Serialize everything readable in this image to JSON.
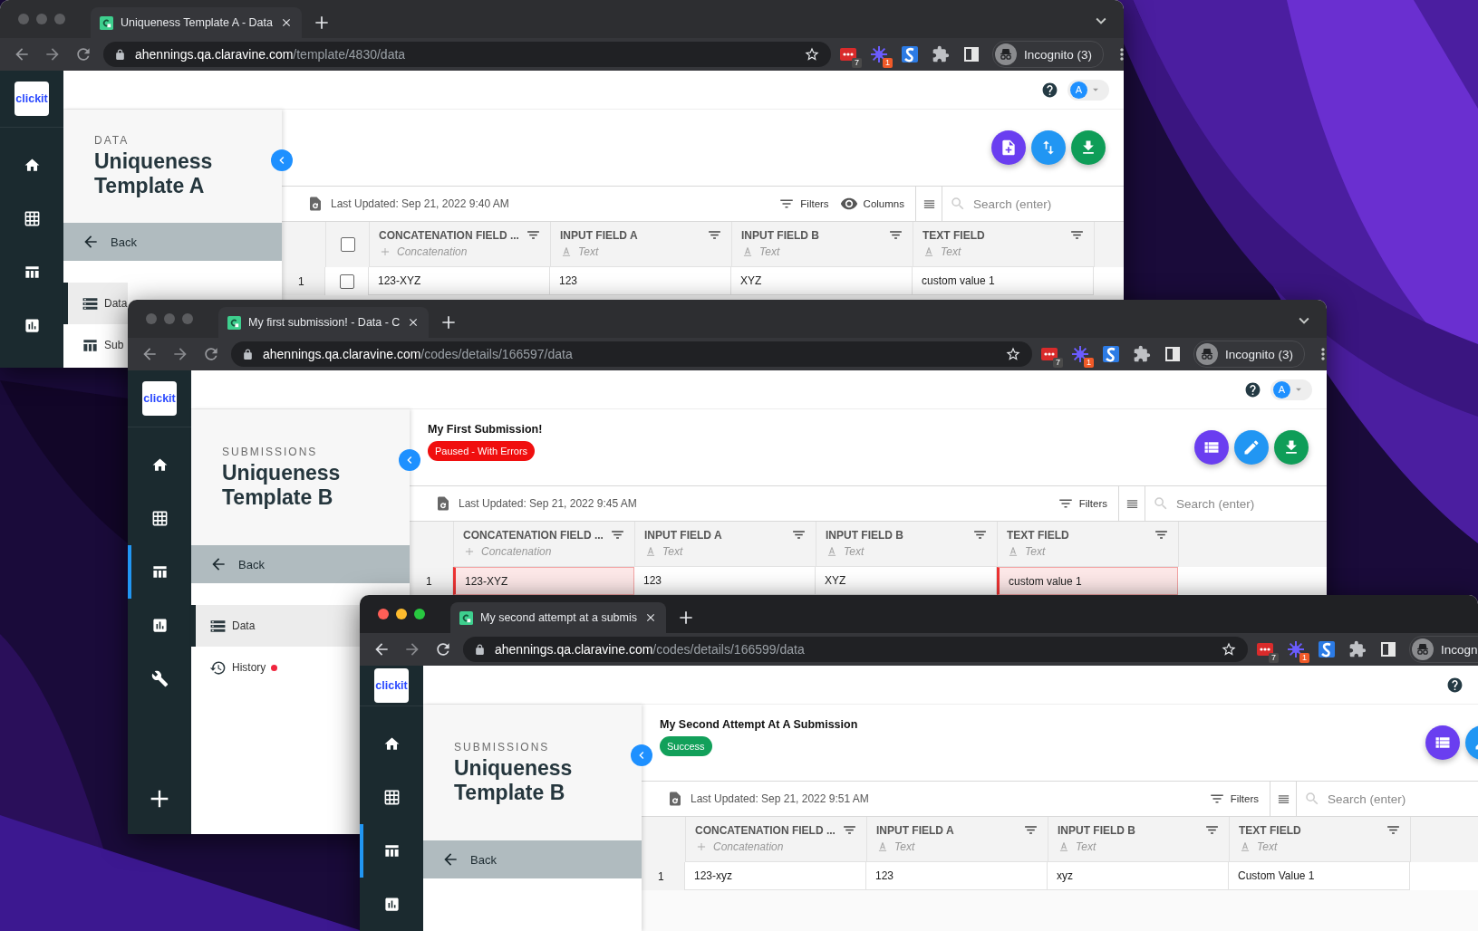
{
  "windows": [
    {
      "focused": false,
      "tab": {
        "title": "Uniqueness Template A - Data"
      },
      "url": "**ahennings.qa.claravine.com**/template/4830/data",
      "extensions": [
        {
          "kind": "dots",
          "badge": "7"
        },
        {
          "kind": "burst",
          "badge": "1"
        },
        {
          "kind": "logo"
        },
        {
          "kind": "puzzle"
        },
        {
          "kind": "sidepanel"
        }
      ],
      "incognito": "Incognito (3)",
      "logo": "clickit",
      "rail": [
        {
          "kind": "home",
          "selected": false
        },
        {
          "kind": "grid",
          "selected": false
        },
        {
          "kind": "table",
          "selected": false
        },
        {
          "kind": "chart",
          "selected": false
        }
      ],
      "avatar": "A",
      "panel": {
        "section": "DATA",
        "title": "Uniqueness Template A",
        "back": "Back",
        "menu": [
          {
            "kind": "data",
            "label": "Data",
            "selected": true,
            "alert": false
          },
          {
            "kind": "submissions",
            "label": "Sub",
            "selected": false,
            "alert": false
          }
        ]
      },
      "fabs": [
        {
          "kind": "new-file"
        },
        {
          "kind": "swap"
        },
        {
          "kind": "download"
        }
      ],
      "toolbar": {
        "last_updated": "Last Updated: Sep 21, 2022 9:40 AM",
        "actions": [
          {
            "kind": "filters",
            "label": "Filters"
          },
          {
            "kind": "columns",
            "label": "Columns"
          }
        ],
        "search_placeholder": "Search (enter)"
      },
      "table": {
        "selectable": true,
        "header_checked": false,
        "columns": [
          {
            "name": "CONCATENATION FIELD ...",
            "kind": "concatenation",
            "type": "Concatenation"
          },
          {
            "name": "INPUT FIELD A",
            "kind": "text",
            "type": "Text"
          },
          {
            "name": "INPUT FIELD B",
            "kind": "text",
            "type": "Text"
          },
          {
            "name": "TEXT FIELD",
            "kind": "text",
            "type": "Text"
          }
        ],
        "rows": [
          {
            "number": "1",
            "checked": false,
            "cells": [
              {
                "text": "123-XYZ",
                "error": false
              },
              {
                "text": "123",
                "error": false
              },
              {
                "text": "XYZ",
                "error": false
              },
              {
                "text": "custom value 1",
                "error": false
              }
            ]
          }
        ]
      }
    },
    {
      "focused": false,
      "tab": {
        "title": "My first submission! - Data - C"
      },
      "url": "**ahennings.qa.claravine.com**/codes/details/166597/data",
      "extensions": [
        {
          "kind": "dots",
          "badge": "7"
        },
        {
          "kind": "burst",
          "badge": "1"
        },
        {
          "kind": "logo"
        },
        {
          "kind": "puzzle"
        },
        {
          "kind": "sidepanel"
        }
      ],
      "incognito": "Incognito (3)",
      "logo": "clickit",
      "rail": [
        {
          "kind": "home",
          "selected": false
        },
        {
          "kind": "grid",
          "selected": false
        },
        {
          "kind": "table",
          "selected": true
        },
        {
          "kind": "chart",
          "selected": false
        },
        {
          "kind": "wrench",
          "selected": false
        },
        {
          "kind": "add",
          "selected": false
        }
      ],
      "avatar": "A",
      "panel": {
        "section": "SUBMISSIONS",
        "title": "Uniqueness Template B",
        "back": "Back",
        "menu": [
          {
            "kind": "data",
            "label": "Data",
            "selected": true,
            "alert": false
          },
          {
            "kind": "history",
            "label": "History",
            "selected": false,
            "alert": true
          }
        ]
      },
      "header": {
        "title": "My First Submission!",
        "status": {
          "kind": "error",
          "label": "Paused - With Errors"
        }
      },
      "fabs": [
        {
          "kind": "list"
        },
        {
          "kind": "edit"
        },
        {
          "kind": "download"
        }
      ],
      "toolbar": {
        "last_updated": "Last Updated: Sep 21, 2022 9:45 AM",
        "actions": [
          {
            "kind": "filters",
            "label": "Filters"
          }
        ],
        "search_placeholder": "Search (enter)"
      },
      "table": {
        "selectable": false,
        "columns": [
          {
            "name": "CONCATENATION FIELD ...",
            "kind": "concatenation",
            "type": "Concatenation"
          },
          {
            "name": "INPUT FIELD A",
            "kind": "text",
            "type": "Text"
          },
          {
            "name": "INPUT FIELD B",
            "kind": "text",
            "type": "Text"
          },
          {
            "name": "TEXT FIELD",
            "kind": "text",
            "type": "Text"
          }
        ],
        "rows": [
          {
            "number": "1",
            "cells": [
              {
                "text": "123-XYZ",
                "error": true
              },
              {
                "text": "123",
                "error": false
              },
              {
                "text": "XYZ",
                "error": false
              },
              {
                "text": "custom value 1",
                "error": true
              }
            ]
          }
        ]
      }
    },
    {
      "focused": true,
      "tab": {
        "title": "My second attempt at a submis"
      },
      "url": "**ahennings.qa.claravine.com**/codes/details/166599/data",
      "extensions": [
        {
          "kind": "dots",
          "badge": "7"
        },
        {
          "kind": "burst",
          "badge": "1"
        },
        {
          "kind": "logo"
        },
        {
          "kind": "puzzle"
        },
        {
          "kind": "sidepanel"
        }
      ],
      "incognito": "Incogn",
      "logo": "clickit",
      "rail": [
        {
          "kind": "home",
          "selected": false
        },
        {
          "kind": "grid",
          "selected": false
        },
        {
          "kind": "table",
          "selected": true
        },
        {
          "kind": "chart",
          "selected": false
        }
      ],
      "panel": {
        "section": "SUBMISSIONS",
        "title": "Uniqueness Template B",
        "back": "Back"
      },
      "header": {
        "title": "My Second Attempt At A Submission",
        "status": {
          "kind": "success",
          "label": "Success"
        }
      },
      "fabs": [
        {
          "kind": "list"
        },
        {
          "kind": "edit"
        }
      ],
      "toolbar": {
        "last_updated": "Last Updated: Sep 21, 2022 9:51 AM",
        "actions": [
          {
            "kind": "filters",
            "label": "Filters"
          }
        ],
        "search_placeholder": "Search (enter)"
      },
      "table": {
        "selectable": false,
        "columns": [
          {
            "name": "CONCATENATION FIELD ...",
            "kind": "concatenation",
            "type": "Concatenation"
          },
          {
            "name": "INPUT FIELD A",
            "kind": "text",
            "type": "Text"
          },
          {
            "name": "INPUT FIELD B",
            "kind": "text",
            "type": "Text"
          },
          {
            "name": "TEXT FIELD",
            "kind": "text",
            "type": "Text"
          }
        ],
        "rows": [
          {
            "number": "1",
            "cells": [
              {
                "text": "123-xyz",
                "error": false
              },
              {
                "text": "123",
                "error": false
              },
              {
                "text": "xyz",
                "error": false
              },
              {
                "text": "Custom Value 1",
                "error": false
              }
            ]
          }
        ]
      }
    }
  ]
}
